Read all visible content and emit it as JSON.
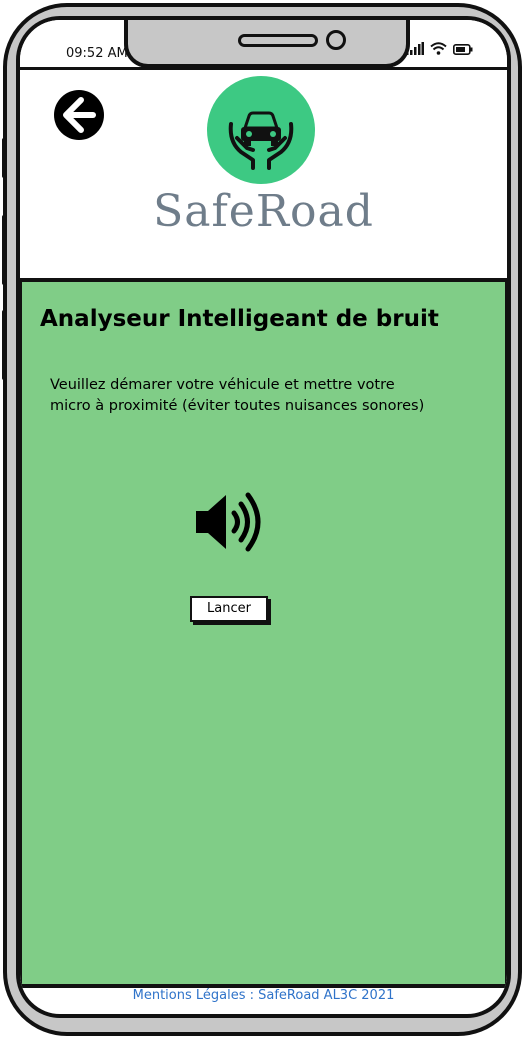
{
  "status_bar": {
    "time": "09:52 AM",
    "icons": [
      "signal-icon",
      "wifi-icon",
      "battery-icon"
    ]
  },
  "header": {
    "back_icon": "arrow-left-circle-icon",
    "logo_icon": "car-in-hands-icon",
    "brand_name": "SafeRoad"
  },
  "main": {
    "title": "Analyseur Intelligeant de bruit",
    "instructions_line1": "Veuillez démarer votre véhicule et mettre votre",
    "instructions_line2": "micro à proximité (éviter toutes nuisances sonores)",
    "speaker_icon": "volume-speaker-icon",
    "launch_label": "Lancer"
  },
  "footer": {
    "text": "Mentions Légales : SafeRoad AL3C 2021"
  },
  "colors": {
    "panel_background": "#80cd87",
    "logo_green": "#3dc983",
    "brand_text": "#6f7d8a",
    "footer_link": "#2f73c9",
    "frame": "#c7c7c7"
  }
}
